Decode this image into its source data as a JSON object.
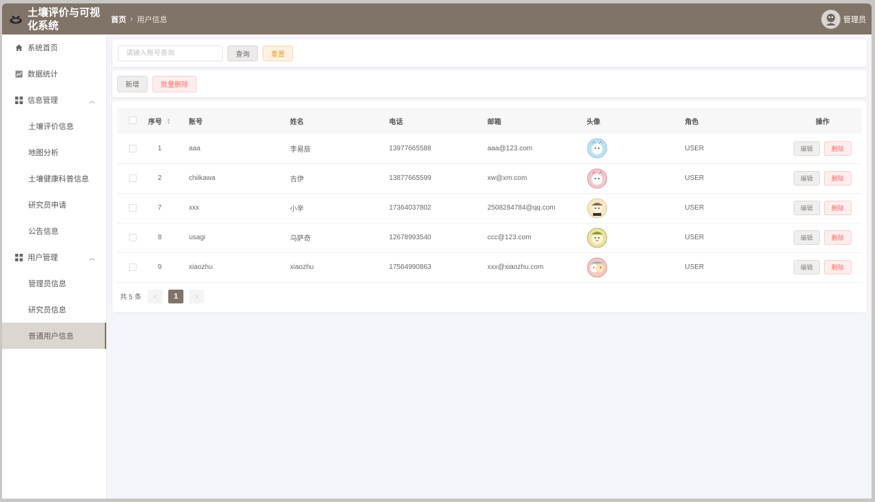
{
  "header": {
    "title": "土壤评价与可视化系统",
    "breadcrumb_home": "首页",
    "breadcrumb_sep": "›",
    "breadcrumb_current": "用户信息",
    "user_name": "管理员"
  },
  "sidebar": {
    "items": [
      {
        "label": "系统首页",
        "icon": "home-icon"
      },
      {
        "label": "数据统计",
        "icon": "chart-icon"
      },
      {
        "label": "信息管理",
        "icon": "grid-icon",
        "expanded": true
      },
      {
        "label": "土壤评价信息"
      },
      {
        "label": "地图分析"
      },
      {
        "label": "土壤健康科普信息"
      },
      {
        "label": "研究员申请"
      },
      {
        "label": "公告信息"
      },
      {
        "label": "用户管理",
        "icon": "grid-icon",
        "expanded": true
      },
      {
        "label": "管理员信息"
      },
      {
        "label": "研究员信息"
      },
      {
        "label": "普通用户信息",
        "active": true
      }
    ]
  },
  "search": {
    "placeholder": "请输入账号查询",
    "query_label": "查询",
    "reset_label": "重置"
  },
  "actions": {
    "add_label": "新增",
    "batch_delete_label": "批量删除"
  },
  "table": {
    "columns": [
      "序号",
      "账号",
      "姓名",
      "电话",
      "邮箱",
      "头像",
      "角色",
      "操作"
    ],
    "rows": [
      {
        "id": "1",
        "account": "aaa",
        "name": "李易辰",
        "phone": "13977665588",
        "email": "aaa@123.com",
        "role": "USER",
        "avatar_color": "#bfe0ee"
      },
      {
        "id": "2",
        "account": "chiikawa",
        "name": "吉伊",
        "phone": "13877665599",
        "email": "xw@xm.com",
        "role": "USER",
        "avatar_color": "#f3c6cd"
      },
      {
        "id": "7",
        "account": "xxx",
        "name": "小辛",
        "phone": "17364037802",
        "email": "2508284784@qq.com",
        "role": "USER",
        "avatar_color": "#f6e7c7"
      },
      {
        "id": "8",
        "account": "usagi",
        "name": "乌萨奇",
        "phone": "12678993540",
        "email": "ccc@123.com",
        "role": "USER",
        "avatar_color": "#e9e3a6"
      },
      {
        "id": "9",
        "account": "xiaozhu",
        "name": "xiaozhu",
        "phone": "17564990863",
        "email": "xxx@xiaozhu.com",
        "role": "USER",
        "avatar_color": "#f4c8c0"
      }
    ],
    "edit_label": "编辑",
    "delete_label": "删除"
  },
  "pagination": {
    "total_text": "共 5 条",
    "prev": "‹",
    "current_page": "1",
    "next": "›"
  },
  "colors": {
    "header_bg": "#807368",
    "active_menu_bg": "#dbd6d0",
    "danger": "#f56c6c",
    "warning": "#e6a23c"
  }
}
